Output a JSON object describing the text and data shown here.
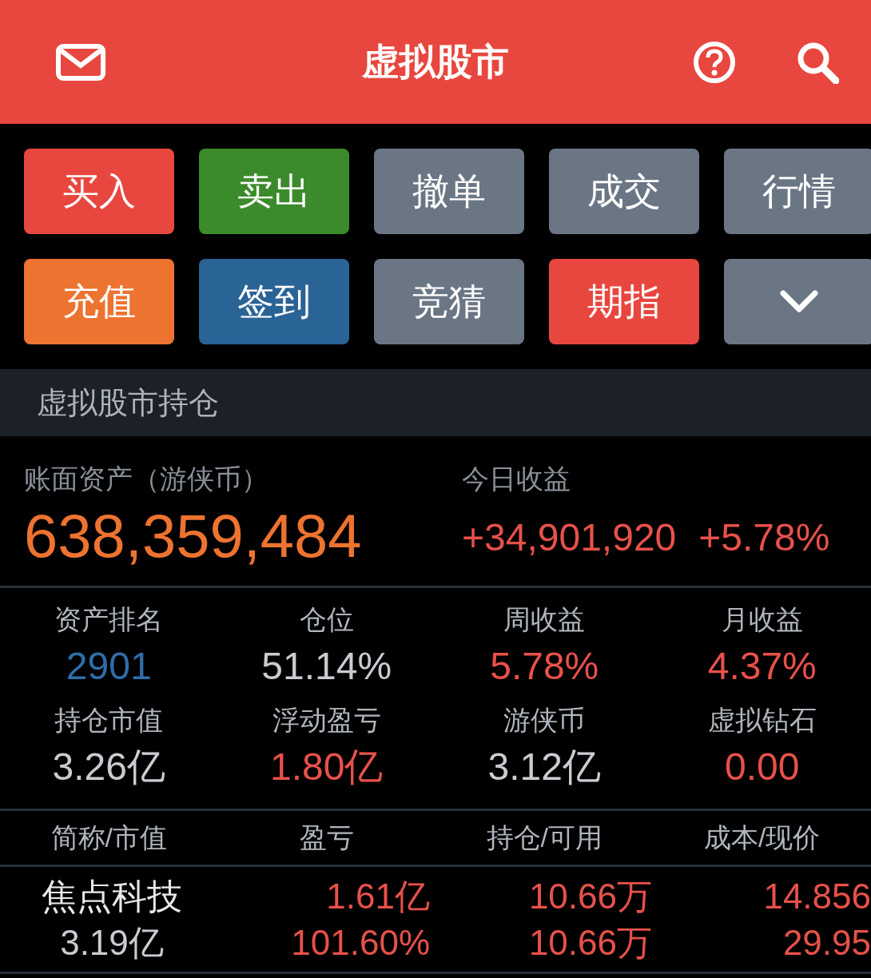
{
  "header": {
    "title": "虚拟股市"
  },
  "actions": [
    {
      "kind": "text",
      "label": "买入",
      "color": "#e8473f"
    },
    {
      "kind": "text",
      "label": "卖出",
      "color": "#3b8a2b"
    },
    {
      "kind": "text",
      "label": "撤单",
      "color": "#6b7685"
    },
    {
      "kind": "text",
      "label": "成交",
      "color": "#6b7685"
    },
    {
      "kind": "text",
      "label": "行情",
      "color": "#6b7685"
    },
    {
      "kind": "text",
      "label": "充值",
      "color": "#ed7330"
    },
    {
      "kind": "text",
      "label": "签到",
      "color": "#2a6396"
    },
    {
      "kind": "text",
      "label": "竞猜",
      "color": "#6b7685"
    },
    {
      "kind": "text",
      "label": "期指",
      "color": "#e8473f"
    },
    {
      "kind": "more",
      "color": "#6b7685"
    }
  ],
  "section_title": "虚拟股市持仓",
  "assets": {
    "label": "账面资产（游侠币）",
    "value": "638,359,484"
  },
  "today": {
    "label": "今日收益",
    "amount": "+34,901,920",
    "percent": "+5.78%"
  },
  "stats": [
    {
      "label": "资产排名",
      "value": "2901",
      "color": "#2f6da8"
    },
    {
      "label": "仓位",
      "value": "51.14%",
      "color": "#c9ccd1"
    },
    {
      "label": "周收益",
      "value": "5.78%",
      "color": "#e8514a"
    },
    {
      "label": "月收益",
      "value": "4.37%",
      "color": "#e8514a"
    },
    {
      "label": "持仓市值",
      "value": "3.26亿",
      "color": "#c9ccd1"
    },
    {
      "label": "浮动盈亏",
      "value": "1.80亿",
      "color": "#e8514a"
    },
    {
      "label": "游侠币",
      "value": "3.12亿",
      "color": "#c9ccd1"
    },
    {
      "label": "虚拟钻石",
      "value": "0.00",
      "color": "#e8514a"
    }
  ],
  "table": {
    "columns": [
      "简称/市值",
      "盈亏",
      "持仓/可用",
      "成本/现价"
    ],
    "rows": [
      {
        "name": "焦点科技",
        "market_value": "3.19亿",
        "profit": "1.61亿",
        "profit_pct": "101.60%",
        "holding": "10.66万",
        "available": "10.66万",
        "cost": "14.856",
        "price": "29.95"
      }
    ]
  }
}
